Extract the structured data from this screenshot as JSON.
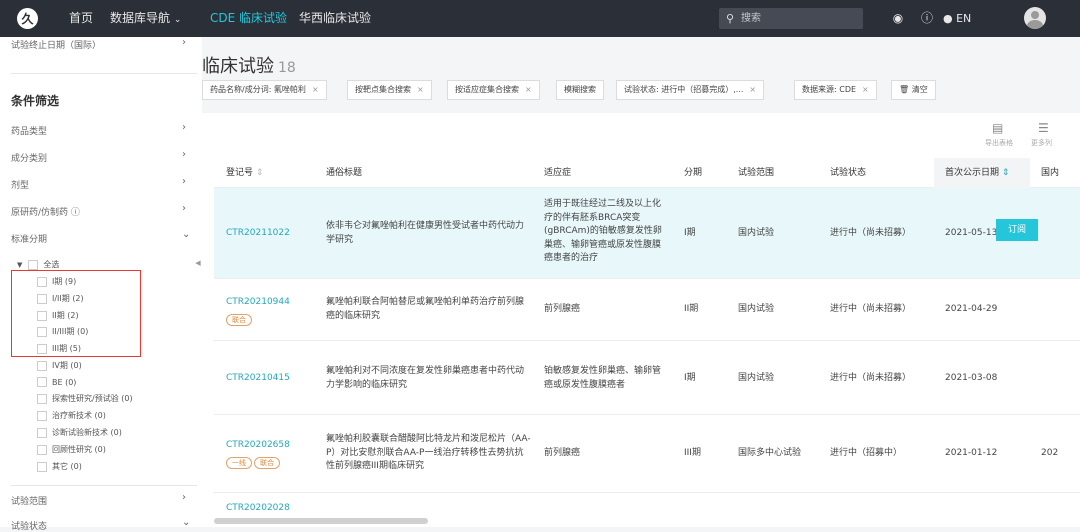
{
  "topbar": {
    "logo": "久",
    "nav_home": "首页",
    "nav_db": "数据库导航",
    "nav_db_caret": "⌄",
    "nav_cde": "CDE 临床试验",
    "nav_huaxi": "华西临床试验",
    "search_placeholder": "搜索",
    "lang": "EN"
  },
  "sidebar": {
    "top_item": "试验终止日期（国际）",
    "title": "条件筛选",
    "filters": [
      "药品类型",
      "成分类别",
      "剂型",
      "原研药/仿制药 ⓘ",
      "标准分期"
    ],
    "select_all": "全选",
    "phases": [
      "I期 (9)",
      "I/II期 (2)",
      "II期 (2)",
      "II/III期 (0)",
      "III期 (5)",
      "IV期 (0)",
      "BE (0)",
      "探索性研究/预试验 (0)",
      "治疗新技术 (0)",
      "诊断试验新技术 (0)",
      "回顾性研究 (0)",
      "其它 (0)"
    ],
    "bottom_1": "试验范围",
    "bottom_2": "试验状态"
  },
  "main": {
    "title": "临床试验",
    "count": "18",
    "chips": [
      "药品名称/成分词: 氟唑帕利",
      "按靶点集合搜索",
      "按适应症集合搜索",
      "模糊搜索",
      "试验状态: 进行中（招募完成）,...",
      "数据来源: CDE",
      "清空"
    ],
    "export_label": "导出表格",
    "more_cols_label": "更多列",
    "columns": [
      "登记号",
      "通俗标题",
      "适应症",
      "分期",
      "试验范围",
      "试验状态",
      "首次公示日期",
      "国内"
    ],
    "subscribe": "订阅",
    "rows": [
      {
        "id": "CTR20211022",
        "title": "依非韦仑对氟唑帕利在健康男性受试者中药代动力学研究",
        "indication": "适用于既往经过二线及以上化疗的伴有胚系BRCA突变(gBRCAm)的铂敏感复发性卵巢癌、输卵管癌或原发性腹膜癌患者的治疗",
        "phase": "I期",
        "scope": "国内试验",
        "status": "进行中（尚未招募）",
        "date": "2021-05-13",
        "tags": []
      },
      {
        "id": "CTR20210944",
        "title": "氟唑帕利联合阿帕替尼或氟唑帕利单药治疗前列腺癌的临床研究",
        "indication": "前列腺癌",
        "phase": "II期",
        "scope": "国内试验",
        "status": "进行中（尚未招募）",
        "date": "2021-04-29",
        "tags": [
          "联合"
        ]
      },
      {
        "id": "CTR20210415",
        "title": "氟唑帕利对不同浓度在复发性卵巢癌患者中药代动力学影响的临床研究",
        "indication": "铂敏感复发性卵巢癌、输卵管癌或原发性腹膜癌者",
        "phase": "I期",
        "scope": "国内试验",
        "status": "进行中（尚未招募）",
        "date": "2021-03-08",
        "tags": []
      },
      {
        "id": "CTR20202658",
        "title": "氟唑帕利胶囊联合醋酸阿比特龙片和泼尼松片（AA-P）对比安慰剂联合AA-P一线治疗转移性去势抗抗性前列腺癌III期临床研究",
        "indication": "前列腺癌",
        "phase": "III期",
        "scope": "国际多中心试验",
        "status": "进行中（招募中）",
        "date": "2021-01-12",
        "extra": "202",
        "tags": [
          "一线",
          "联合"
        ]
      },
      {
        "id": "CTR20202028",
        "title": "",
        "indication": "",
        "phase": "",
        "scope": "",
        "status": "",
        "date": "",
        "tags": []
      }
    ]
  }
}
